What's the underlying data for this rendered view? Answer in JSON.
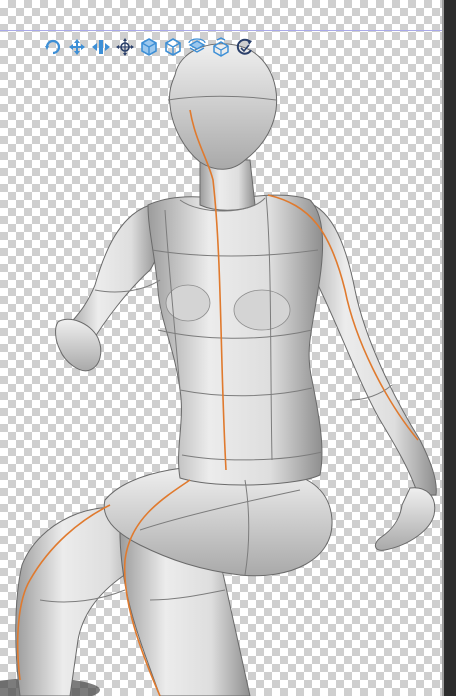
{
  "canvas": {
    "colors": {
      "checker_light": "#ffffff",
      "checker_dark": "#cfcfcf",
      "guide": "#a9a9e8",
      "tool_blue": "#3d8fd6",
      "model_skin": "#e4e4e4",
      "model_line": "#7c7c7c",
      "center_line": "#e07a2e"
    }
  },
  "toolbar": {
    "tools": [
      {
        "name": "camera-rotate-icon"
      },
      {
        "name": "camera-pan-icon"
      },
      {
        "name": "camera-dolly-icon"
      },
      {
        "name": "move-object-icon"
      },
      {
        "name": "rotate-object-icon"
      },
      {
        "name": "rotate-object-screen-icon"
      },
      {
        "name": "rotate-object-view-icon"
      },
      {
        "name": "rotate-object-free-icon"
      },
      {
        "name": "reset-pose-icon"
      }
    ]
  }
}
